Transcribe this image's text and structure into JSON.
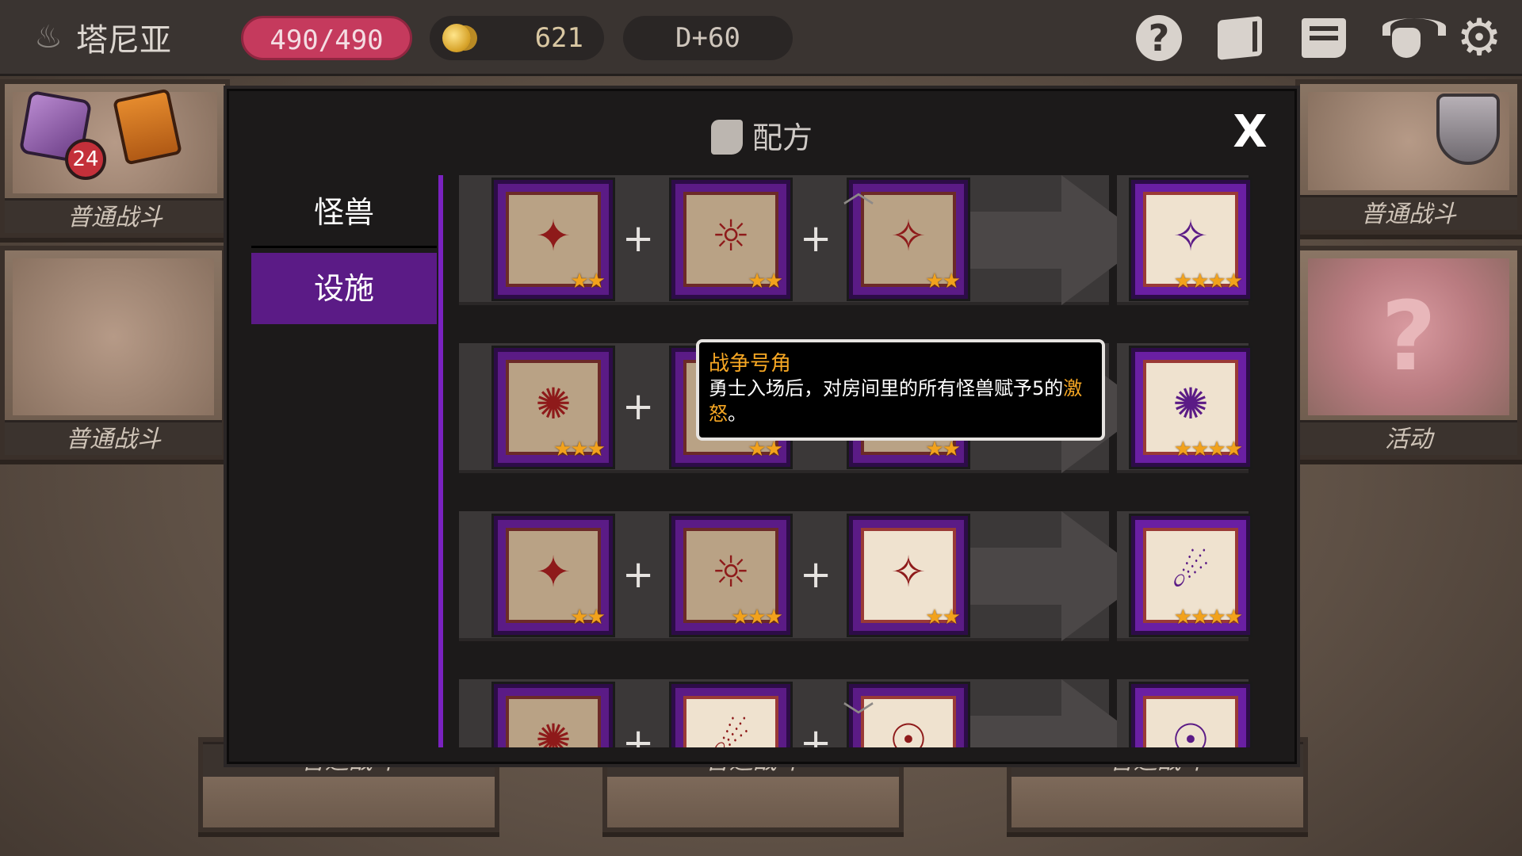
{
  "header": {
    "player_name": "塔尼亚",
    "hp": "490/490",
    "gold": "621",
    "day": "D+60",
    "help_glyph": "?",
    "icons": [
      "help-icon",
      "codex-icon",
      "scroll-icon",
      "monster-icon",
      "gear-icon"
    ]
  },
  "side": {
    "cube_badge": "24"
  },
  "background_cards": {
    "labels": [
      "普通战斗",
      "普通战斗",
      "普通战斗",
      "活动",
      "普通战斗",
      "普通战斗",
      "普通战斗"
    ]
  },
  "modal": {
    "title": "配方",
    "close_label": "X",
    "tabs": [
      {
        "label": "怪兽",
        "active": false
      },
      {
        "label": "设施",
        "active": true
      }
    ],
    "recipes": [
      {
        "inputs": [
          {
            "stars": 2,
            "style": "dark"
          },
          {
            "stars": 2,
            "style": "dark"
          },
          {
            "stars": 2,
            "style": "dark"
          }
        ],
        "result_stars": 4
      },
      {
        "inputs": [
          {
            "stars": 3,
            "style": "dark"
          },
          {
            "stars": 2,
            "style": "dark"
          },
          {
            "stars": 2,
            "style": "dark"
          }
        ],
        "result_stars": 4
      },
      {
        "inputs": [
          {
            "stars": 2,
            "style": "dark"
          },
          {
            "stars": 3,
            "style": "dark"
          },
          {
            "stars": 2,
            "style": "light"
          }
        ],
        "result_stars": 4
      },
      {
        "inputs": [
          {
            "stars": 0,
            "style": "dark"
          },
          {
            "stars": 0,
            "style": "light"
          },
          {
            "stars": 0,
            "style": "light"
          }
        ],
        "result_stars": 0
      }
    ],
    "plus_symbol": "+",
    "star_glyph": "★"
  },
  "tooltip": {
    "title": "战争号角",
    "text_before": "勇士入场后，对房间里的所有怪兽赋予5的",
    "highlight": "激怒",
    "text_after": "。"
  },
  "colors": {
    "accent_purple": "#5b1b86",
    "hp_red": "#c53a5d",
    "star_gold": "#f2a21c",
    "tooltip_title": "#f5a623"
  }
}
